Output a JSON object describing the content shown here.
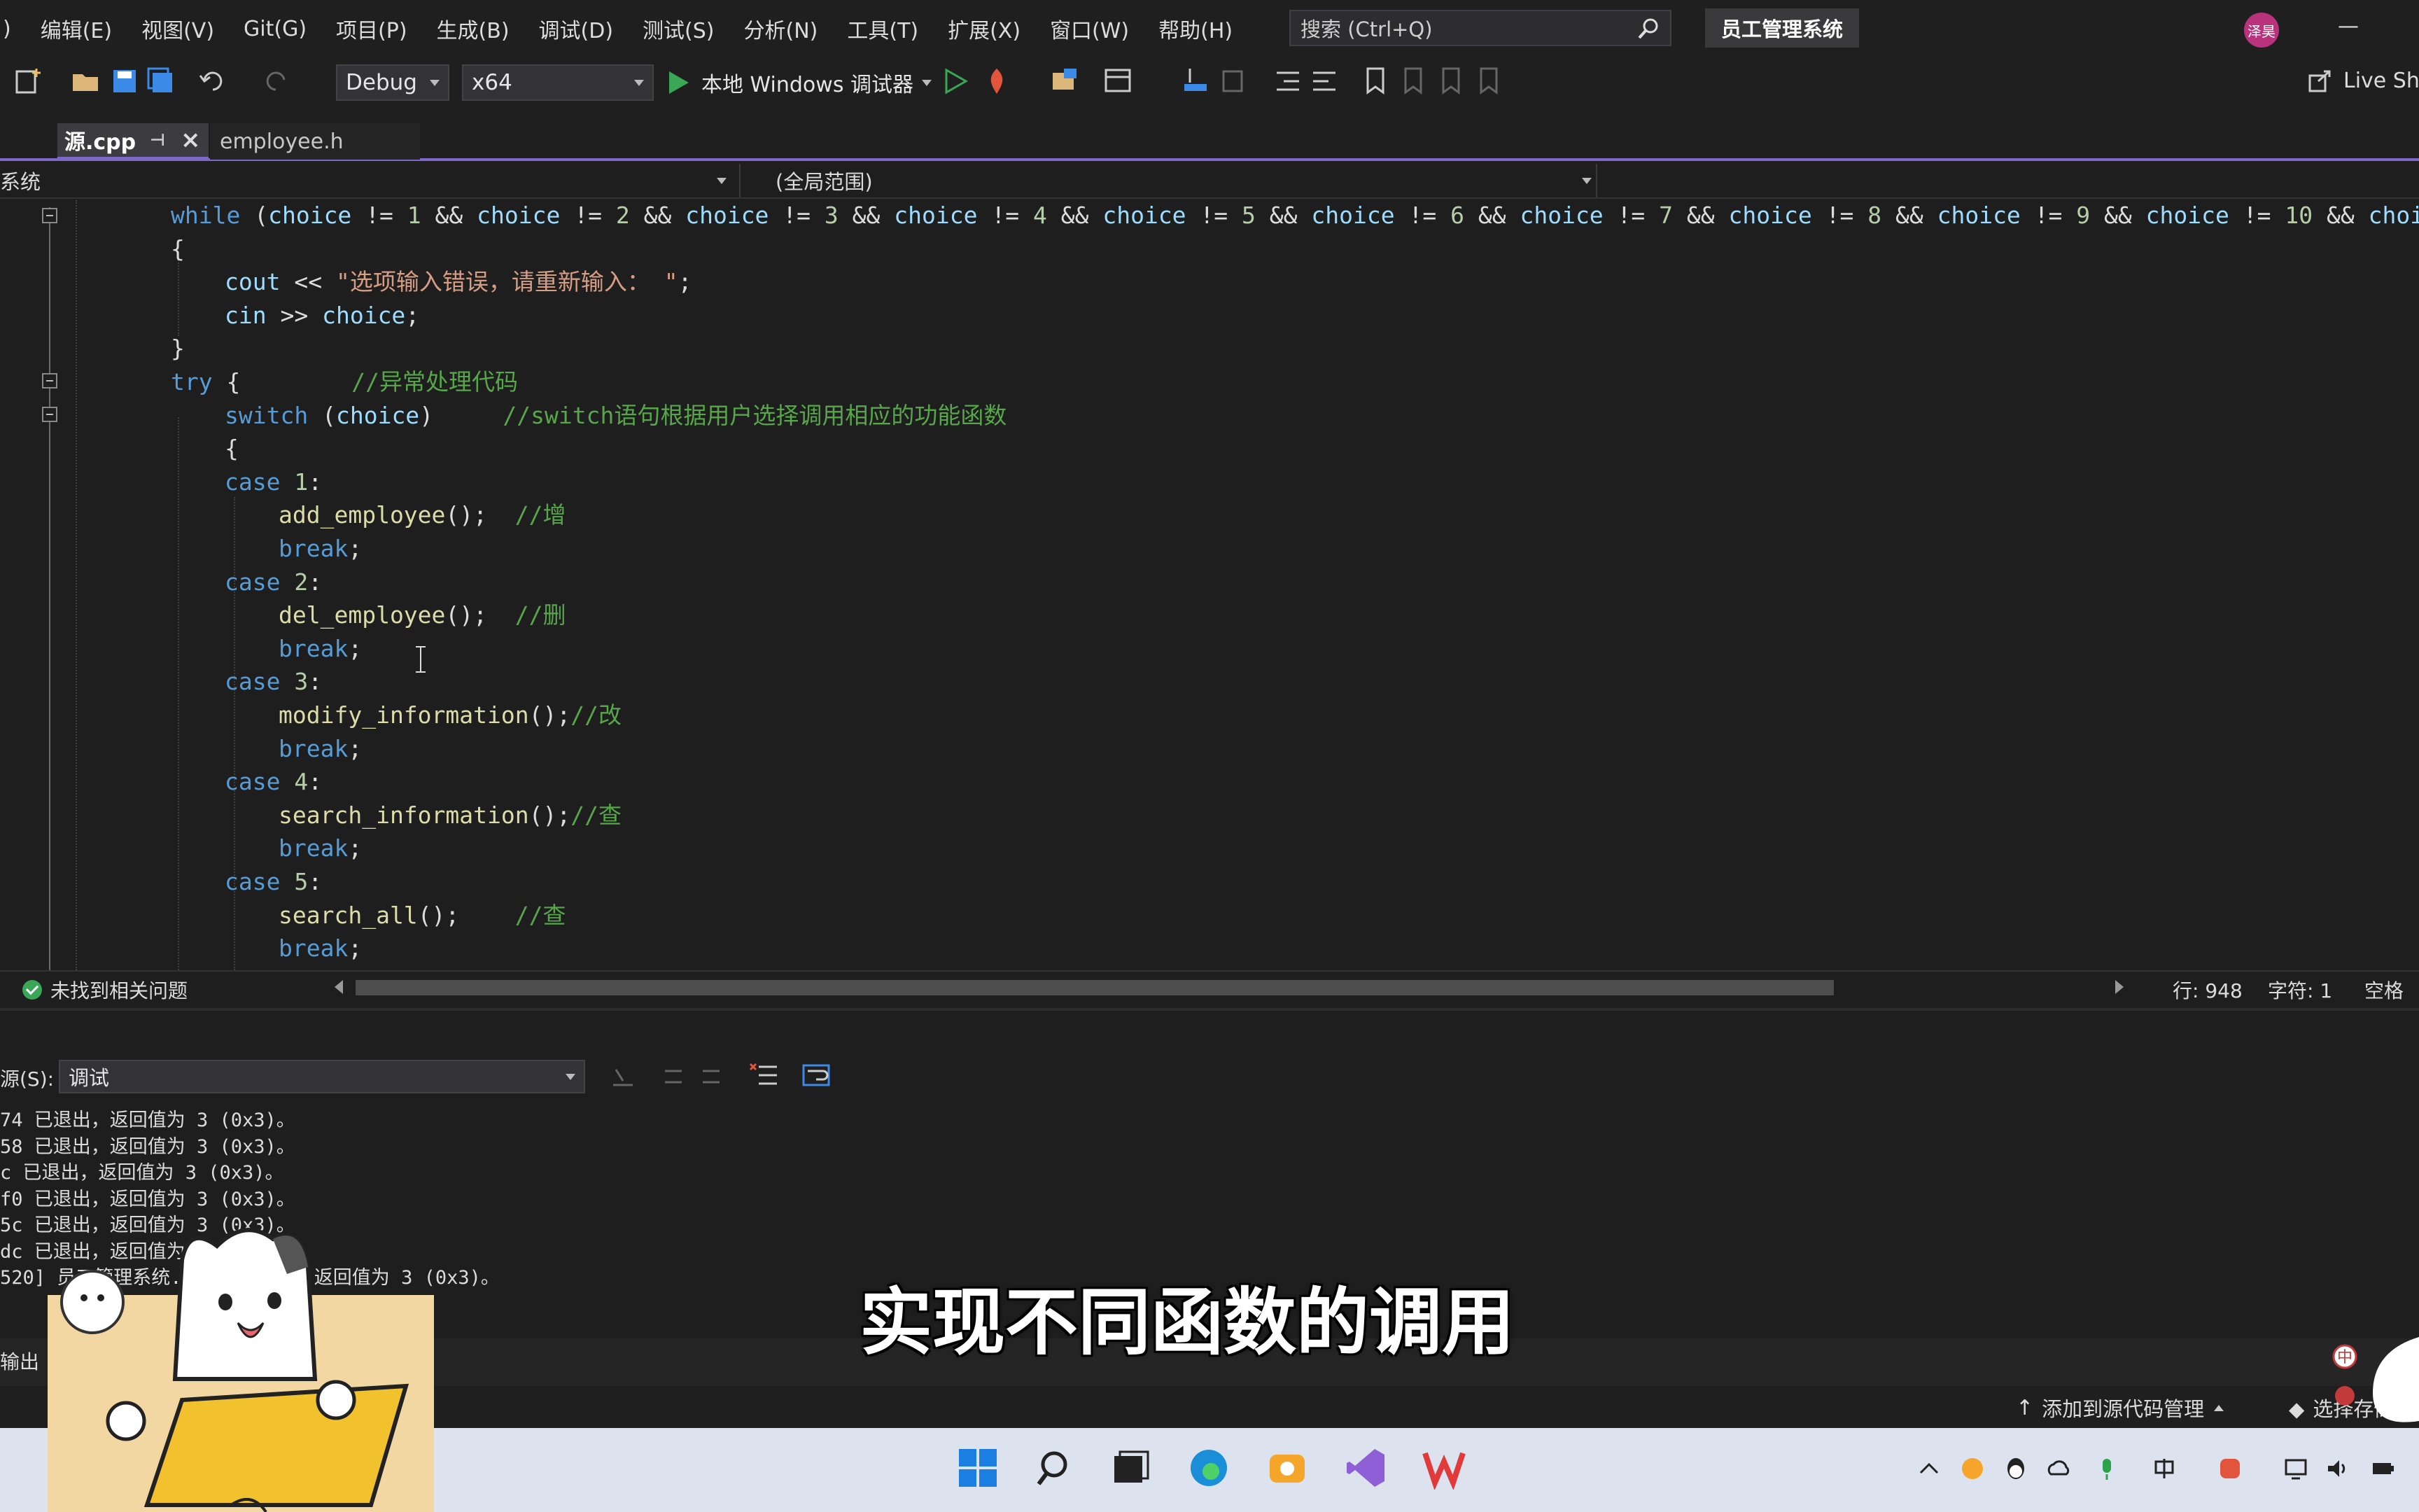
{
  "menu": {
    "items": [
      ")",
      "编辑(E)",
      "视图(V)",
      "Git(G)",
      "项目(P)",
      "生成(B)",
      "调试(D)",
      "测试(S)",
      "分析(N)",
      "工具(T)",
      "扩展(X)",
      "窗口(W)",
      "帮助(H)"
    ],
    "search_placeholder": "搜索 (Ctrl+Q)",
    "solution_name": "员工管理系统",
    "avatar_text": "泽昊"
  },
  "toolbar": {
    "configuration": "Debug",
    "platform": "x64",
    "debugger_label": "本地 Windows 调试器",
    "live_share": "Live Sh"
  },
  "tabs": [
    {
      "label": "源.cpp",
      "active": true
    },
    {
      "label": "employee.h",
      "active": false
    }
  ],
  "navbar": {
    "project": "系统",
    "scope": "(全局范围)"
  },
  "code": {
    "while_line": [
      {
        "c": "kw",
        "t": "while"
      },
      {
        "c": "plain",
        "t": " ("
      },
      {
        "c": "var",
        "t": "choice"
      },
      {
        "c": "plain",
        "t": " != "
      },
      {
        "c": "num",
        "t": "1"
      },
      {
        "c": "plain",
        "t": " && "
      },
      {
        "c": "var",
        "t": "choice"
      },
      {
        "c": "plain",
        "t": " != "
      },
      {
        "c": "num",
        "t": "2"
      },
      {
        "c": "plain",
        "t": " && "
      },
      {
        "c": "var",
        "t": "choice"
      },
      {
        "c": "plain",
        "t": " != "
      },
      {
        "c": "num",
        "t": "3"
      },
      {
        "c": "plain",
        "t": " && "
      },
      {
        "c": "var",
        "t": "choice"
      },
      {
        "c": "plain",
        "t": " != "
      },
      {
        "c": "num",
        "t": "4"
      },
      {
        "c": "plain",
        "t": " && "
      },
      {
        "c": "var",
        "t": "choice"
      },
      {
        "c": "plain",
        "t": " != "
      },
      {
        "c": "num",
        "t": "5"
      },
      {
        "c": "plain",
        "t": " && "
      },
      {
        "c": "var",
        "t": "choice"
      },
      {
        "c": "plain",
        "t": " != "
      },
      {
        "c": "num",
        "t": "6"
      },
      {
        "c": "plain",
        "t": " && "
      },
      {
        "c": "var",
        "t": "choice"
      },
      {
        "c": "plain",
        "t": " != "
      },
      {
        "c": "num",
        "t": "7"
      },
      {
        "c": "plain",
        "t": " && "
      },
      {
        "c": "var",
        "t": "choice"
      },
      {
        "c": "plain",
        "t": " != "
      },
      {
        "c": "num",
        "t": "8"
      },
      {
        "c": "plain",
        "t": " && "
      },
      {
        "c": "var",
        "t": "choice"
      },
      {
        "c": "plain",
        "t": " != "
      },
      {
        "c": "num",
        "t": "9"
      },
      {
        "c": "plain",
        "t": " && "
      },
      {
        "c": "var",
        "t": "choice"
      },
      {
        "c": "plain",
        "t": " != "
      },
      {
        "c": "num",
        "t": "10"
      },
      {
        "c": "plain",
        "t": " && "
      },
      {
        "c": "var",
        "t": "choice"
      },
      {
        "c": "plain",
        "t": " !"
      }
    ],
    "lines": [
      {
        "indent": 0,
        "tokens": [
          {
            "c": "plain",
            "t": "{"
          }
        ]
      },
      {
        "indent": 1,
        "tokens": [
          {
            "c": "var",
            "t": "cout"
          },
          {
            "c": "plain",
            "t": " << "
          },
          {
            "c": "str",
            "t": "\"选项输入错误，请重新输入： \""
          },
          {
            "c": "plain",
            "t": ";"
          }
        ]
      },
      {
        "indent": 1,
        "tokens": [
          {
            "c": "var",
            "t": "cin"
          },
          {
            "c": "plain",
            "t": " >> "
          },
          {
            "c": "var",
            "t": "choice"
          },
          {
            "c": "plain",
            "t": ";"
          }
        ]
      },
      {
        "indent": 0,
        "tokens": [
          {
            "c": "plain",
            "t": "}"
          }
        ]
      },
      {
        "indent": 0,
        "tokens": [
          {
            "c": "kw",
            "t": "try"
          },
          {
            "c": "plain",
            "t": " {        "
          },
          {
            "c": "cmt",
            "t": "//异常处理代码"
          }
        ]
      },
      {
        "indent": 1,
        "tokens": [
          {
            "c": "kw",
            "t": "switch"
          },
          {
            "c": "plain",
            "t": " ("
          },
          {
            "c": "var",
            "t": "choice"
          },
          {
            "c": "plain",
            "t": ")     "
          },
          {
            "c": "cmt",
            "t": "//switch语句根据用户选择调用相应的功能函数"
          }
        ]
      },
      {
        "indent": 1,
        "tokens": [
          {
            "c": "plain",
            "t": "{"
          }
        ]
      },
      {
        "indent": 1,
        "tokens": [
          {
            "c": "kw",
            "t": "case"
          },
          {
            "c": "plain",
            "t": " "
          },
          {
            "c": "num",
            "t": "1"
          },
          {
            "c": "plain",
            "t": ":"
          }
        ]
      },
      {
        "indent": 2,
        "tokens": [
          {
            "c": "fn",
            "t": "add_employee"
          },
          {
            "c": "plain",
            "t": "();  "
          },
          {
            "c": "cmt",
            "t": "//增"
          }
        ]
      },
      {
        "indent": 2,
        "tokens": [
          {
            "c": "kw",
            "t": "break"
          },
          {
            "c": "plain",
            "t": ";"
          }
        ]
      },
      {
        "indent": 1,
        "tokens": [
          {
            "c": "kw",
            "t": "case"
          },
          {
            "c": "plain",
            "t": " "
          },
          {
            "c": "num",
            "t": "2"
          },
          {
            "c": "plain",
            "t": ":"
          }
        ]
      },
      {
        "indent": 2,
        "tokens": [
          {
            "c": "fn",
            "t": "del_employee"
          },
          {
            "c": "plain",
            "t": "();  "
          },
          {
            "c": "cmt",
            "t": "//删"
          }
        ]
      },
      {
        "indent": 2,
        "tokens": [
          {
            "c": "kw",
            "t": "break"
          },
          {
            "c": "plain",
            "t": ";"
          }
        ]
      },
      {
        "indent": 1,
        "tokens": [
          {
            "c": "kw",
            "t": "case"
          },
          {
            "c": "plain",
            "t": " "
          },
          {
            "c": "num",
            "t": "3"
          },
          {
            "c": "plain",
            "t": ":"
          }
        ]
      },
      {
        "indent": 2,
        "tokens": [
          {
            "c": "fn",
            "t": "modify_information"
          },
          {
            "c": "plain",
            "t": "();"
          },
          {
            "c": "cmt",
            "t": "//改"
          }
        ]
      },
      {
        "indent": 2,
        "tokens": [
          {
            "c": "kw",
            "t": "break"
          },
          {
            "c": "plain",
            "t": ";"
          }
        ]
      },
      {
        "indent": 1,
        "tokens": [
          {
            "c": "kw",
            "t": "case"
          },
          {
            "c": "plain",
            "t": " "
          },
          {
            "c": "num",
            "t": "4"
          },
          {
            "c": "plain",
            "t": ":"
          }
        ]
      },
      {
        "indent": 2,
        "tokens": [
          {
            "c": "fn",
            "t": "search_information"
          },
          {
            "c": "plain",
            "t": "();"
          },
          {
            "c": "cmt",
            "t": "//查"
          }
        ]
      },
      {
        "indent": 2,
        "tokens": [
          {
            "c": "kw",
            "t": "break"
          },
          {
            "c": "plain",
            "t": ";"
          }
        ]
      },
      {
        "indent": 1,
        "tokens": [
          {
            "c": "kw",
            "t": "case"
          },
          {
            "c": "plain",
            "t": " "
          },
          {
            "c": "num",
            "t": "5"
          },
          {
            "c": "plain",
            "t": ":"
          }
        ]
      },
      {
        "indent": 2,
        "tokens": [
          {
            "c": "fn",
            "t": "search_all"
          },
          {
            "c": "plain",
            "t": "();    "
          },
          {
            "c": "cmt",
            "t": "//查"
          }
        ]
      },
      {
        "indent": 2,
        "tokens": [
          {
            "c": "kw",
            "t": "break"
          },
          {
            "c": "plain",
            "t": ";"
          }
        ]
      }
    ]
  },
  "editor_status": {
    "issues": "未找到相关问题",
    "line": "行: 948",
    "col": "字符: 1",
    "whitespace": "空格"
  },
  "output": {
    "label": "源(S):",
    "source": "调试",
    "lines": [
      "74 已退出，返回值为 3 (0x3)。",
      "58 已退出，返回值为 3 (0x3)。",
      "c 已退出，返回值为 3 (0x3)。",
      "f0 已退出，返回值为 3 (0x3)。",
      "5c 已退出，返回值为 3 (0x3)。",
      "dc 已退出，返回值为 3 (0x3)。",
      "520] 员工管理系统.exe\" 已退出，返回值为 3 (0x3)。"
    ],
    "tab": "输出"
  },
  "subtitle": "实现不同函数的调用",
  "statusbar": {
    "source_control": "添加到源代码管理",
    "repo": "选择存储"
  },
  "colors": {
    "accent": "#7b68c9",
    "keyword": "#569cd6",
    "variable": "#9cdcfe",
    "function": "#dcdcaa",
    "string": "#d69d85",
    "comment": "#57a64a"
  }
}
